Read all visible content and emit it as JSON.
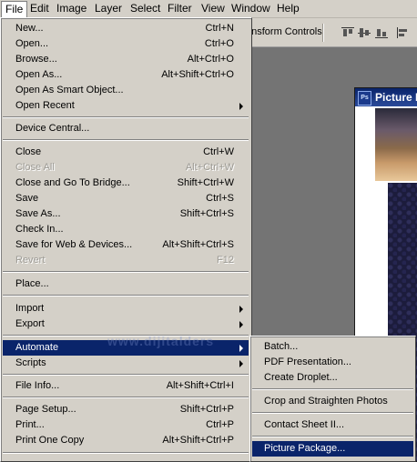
{
  "menubar": {
    "items": [
      {
        "label": "File",
        "active": true
      },
      {
        "label": "Edit"
      },
      {
        "label": "Image"
      },
      {
        "label": "Layer"
      },
      {
        "label": "Select"
      },
      {
        "label": "Filter"
      },
      {
        "label": "View"
      },
      {
        "label": "Window"
      },
      {
        "label": "Help"
      }
    ]
  },
  "options_bar": {
    "transform_controls_label": "ansform Controls"
  },
  "document": {
    "title": "Picture P",
    "logo": "Ps"
  },
  "watermark": "www.dijitalders",
  "file_menu": {
    "items": [
      {
        "label": "New...",
        "shortcut": "Ctrl+N"
      },
      {
        "label": "Open...",
        "shortcut": "Ctrl+O"
      },
      {
        "label": "Browse...",
        "shortcut": "Alt+Ctrl+O"
      },
      {
        "label": "Open As...",
        "shortcut": "Alt+Shift+Ctrl+O"
      },
      {
        "label": "Open As Smart Object..."
      },
      {
        "label": "Open Recent"
      },
      {
        "label": "Device Central..."
      },
      {
        "label": "Close",
        "shortcut": "Ctrl+W"
      },
      {
        "label": "Close All",
        "shortcut": "Alt+Ctrl+W",
        "disabled": true
      },
      {
        "label": "Close and Go To Bridge...",
        "shortcut": "Shift+Ctrl+W"
      },
      {
        "label": "Save",
        "shortcut": "Ctrl+S"
      },
      {
        "label": "Save As...",
        "shortcut": "Shift+Ctrl+S"
      },
      {
        "label": "Check In..."
      },
      {
        "label": "Save for Web & Devices...",
        "shortcut": "Alt+Shift+Ctrl+S"
      },
      {
        "label": "Revert",
        "shortcut": "F12",
        "disabled": true
      },
      {
        "label": "Place..."
      },
      {
        "label": "Import"
      },
      {
        "label": "Export"
      },
      {
        "label": "Automate",
        "highlighted": true
      },
      {
        "label": "Scripts"
      },
      {
        "label": "File Info...",
        "shortcut": "Alt+Shift+Ctrl+I"
      },
      {
        "label": "Page Setup...",
        "shortcut": "Shift+Ctrl+P"
      },
      {
        "label": "Print...",
        "shortcut": "Ctrl+P"
      },
      {
        "label": "Print One Copy",
        "shortcut": "Alt+Shift+Ctrl+P"
      }
    ]
  },
  "automate_menu": {
    "items": [
      {
        "label": "Batch..."
      },
      {
        "label": "PDF Presentation..."
      },
      {
        "label": "Create Droplet..."
      },
      {
        "label": "Crop and Straighten Photos"
      },
      {
        "label": "Contact Sheet II..."
      },
      {
        "label": "Picture Package...",
        "highlighted": true
      }
    ]
  },
  "colors": {
    "menu_bg": "#d4d0c8",
    "highlight": "#0a246a",
    "disabled_text": "#9c9a94",
    "workspace": "#747474"
  }
}
